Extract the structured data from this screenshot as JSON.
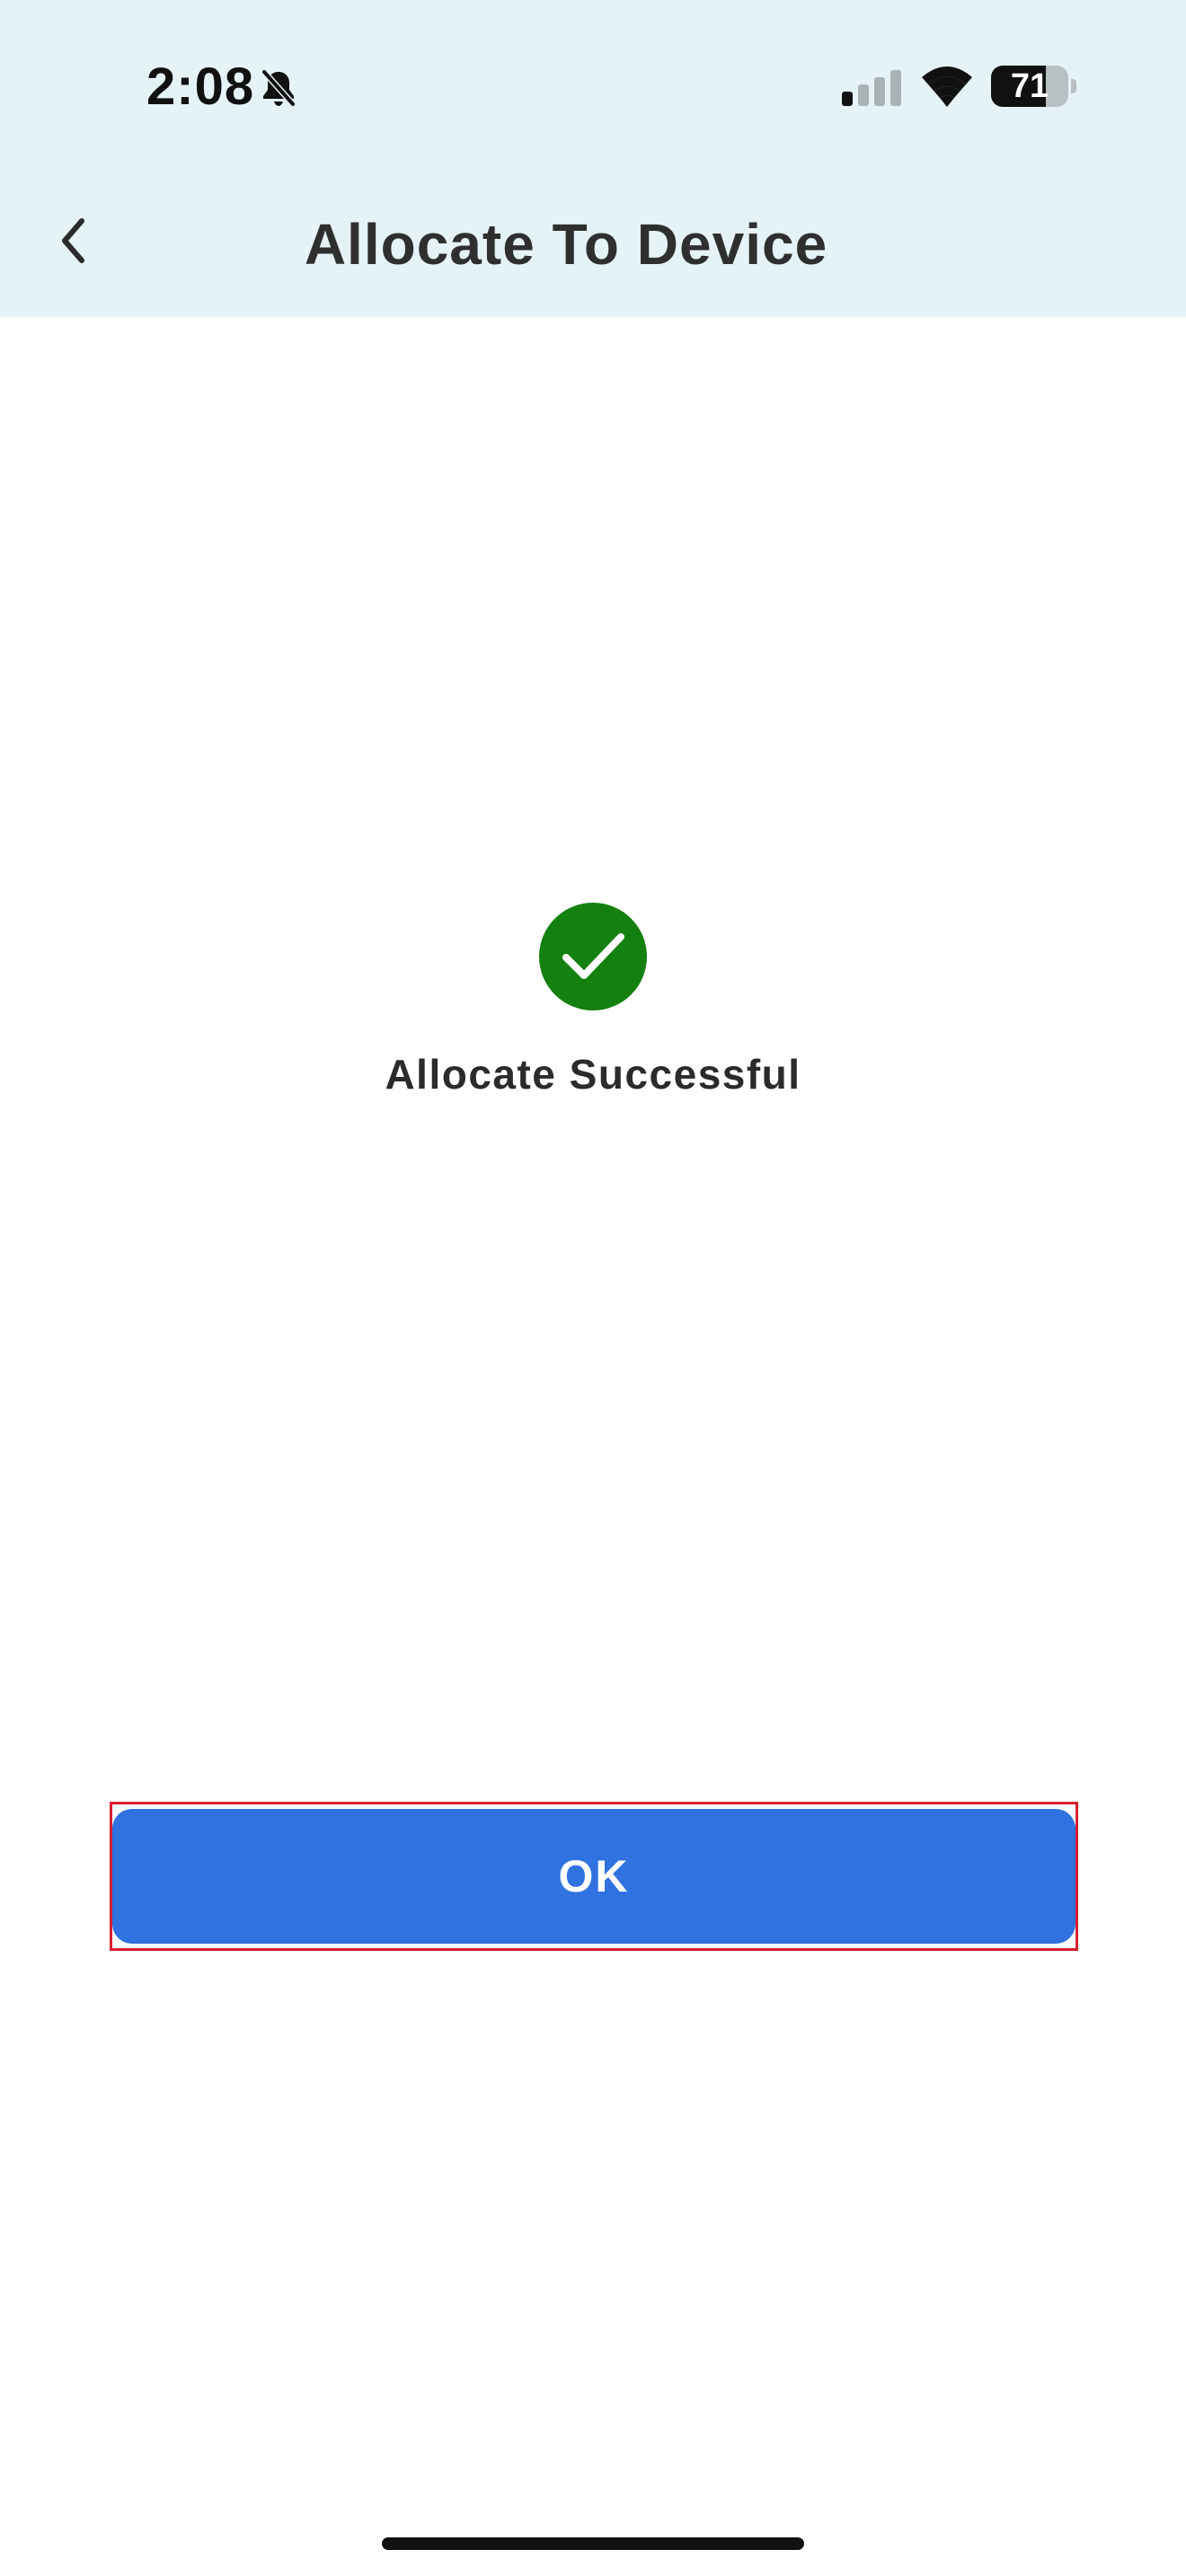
{
  "status_bar": {
    "time": "2:08",
    "battery_level": "71",
    "icons": [
      "silent-bell-icon",
      "signal-icon",
      "wifi-icon",
      "battery-icon"
    ]
  },
  "header": {
    "title": "Allocate To Device",
    "back_icon": "chevron-left-icon"
  },
  "content": {
    "status_icon": "checkmark-circle-icon",
    "message": "Allocate Successful"
  },
  "actions": {
    "ok_label": "OK"
  },
  "colors": {
    "header_background": "#e6f3f6",
    "success_green": "#14800f",
    "primary_blue": "#2f72e0",
    "highlight_red": "#d91f2f"
  }
}
